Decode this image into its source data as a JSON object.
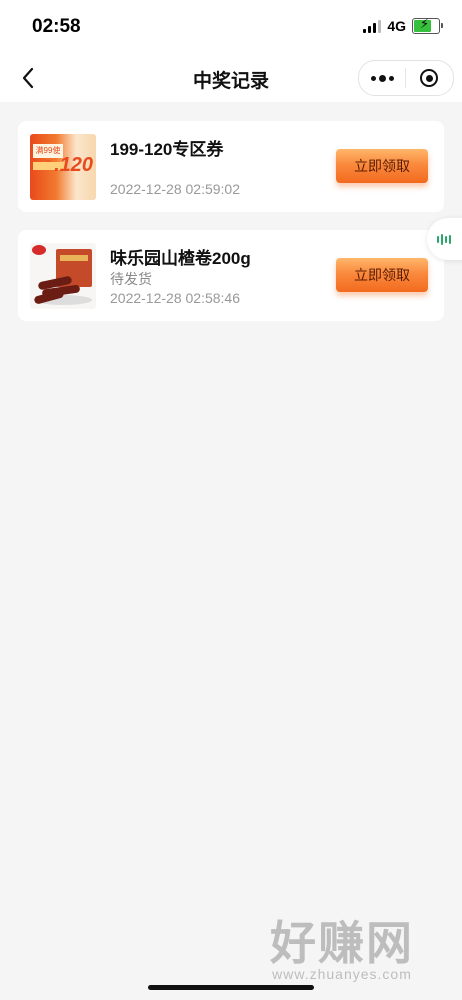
{
  "status_bar": {
    "time": "02:58",
    "network": "4G",
    "battery_level": 0.7
  },
  "nav": {
    "title": "中奖记录"
  },
  "records": [
    {
      "title": "199-120专区券",
      "status": "",
      "time": "2022-12-28 02:59:02",
      "button": "立即领取",
      "thumb_tag": "满99使用",
      "thumb_amount": ".120"
    },
    {
      "title": "味乐园山楂卷200g",
      "status": "待发货",
      "time": "2022-12-28 02:58:46",
      "button": "立即领取"
    }
  ],
  "watermark": {
    "main": "好赚网",
    "sub": "www.zhuanyes.com"
  },
  "colors": {
    "accent": "#f26a1e",
    "background": "#f5f5f5",
    "float_icon": "#2aa56c"
  },
  "icons": [
    "back-icon",
    "more-dots-icon",
    "close-target-icon",
    "voice-wave-icon",
    "signal-icon",
    "battery-icon"
  ]
}
